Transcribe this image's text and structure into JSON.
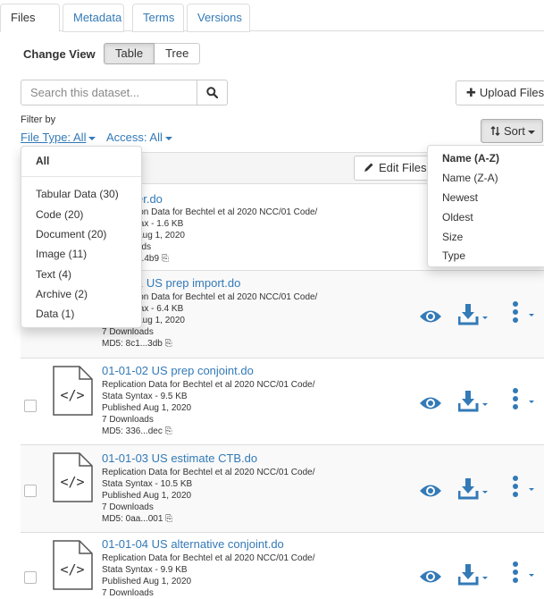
{
  "tabs": [
    "Files",
    "Metadata",
    "Terms",
    "Versions"
  ],
  "change_view": {
    "label": "Change View",
    "table": "Table",
    "tree": "Tree"
  },
  "search": {
    "placeholder": "Search this dataset..."
  },
  "upload_label": "Upload Files",
  "filter": {
    "by": "Filter by",
    "file_type": "File Type: All",
    "access": "Access: All"
  },
  "sort_label": "Sort",
  "edit_files_label": "Edit Files",
  "file_type_menu": {
    "all": "All",
    "items": [
      "Tabular Data (30)",
      "Code (20)",
      "Document (20)",
      "Image (11)",
      "Text (4)",
      "Archive (2)",
      "Data (1)"
    ]
  },
  "sort_menu": {
    "selected": "Name (A-Z)",
    "items": [
      "Name (Z-A)",
      "Newest",
      "Oldest",
      "Size",
      "Type"
    ]
  },
  "files": [
    {
      "name_visible": "er.do",
      "description_visible": "ion Data for Bechtel et al 2020 NCC/01 Code/",
      "type_size_visible": "tax - 1.6 KB",
      "published_visible": "Aug 1, 2020",
      "downloads_visible": "ads",
      "md5_visible": "...4b9"
    },
    {
      "name_visible": "1 US prep import.do",
      "description_visible": "ion Data for Bechtel et al 2020 NCC/01 Code/",
      "type_size_visible": "tax - 6.4 KB",
      "published_visible": "Aug 1, 2020",
      "downloads": "7 Downloads",
      "md5": "MD5: 8c1...3db"
    },
    {
      "name": "01-01-02 US prep conjoint.do",
      "description": "Replication Data for Bechtel et al 2020 NCC/01 Code/",
      "type_size": "Stata Syntax - 9.5 KB",
      "published": "Published Aug 1, 2020",
      "downloads": "7 Downloads",
      "md5": "MD5: 336...dec"
    },
    {
      "name": "01-01-03 US estimate CTB.do",
      "description": "Replication Data for Bechtel et al 2020 NCC/01 Code/",
      "type_size": "Stata Syntax - 10.5 KB",
      "published": "Published Aug 1, 2020",
      "downloads": "7 Downloads",
      "md5": "MD5: 0aa...001"
    },
    {
      "name": "01-01-04 US alternative conjoint.do",
      "description": "Replication Data for Bechtel et al 2020 NCC/01 Code/",
      "type_size": "Stata Syntax - 9.9 KB",
      "published": "Published Aug 1, 2020",
      "downloads": "7 Downloads"
    }
  ],
  "colors": {
    "link": "#337ab7",
    "action": "#337ab7"
  },
  "icons": [
    "search-icon",
    "plus-icon",
    "sort-icon",
    "pencil-icon",
    "file-code-icon",
    "eye-icon",
    "download-icon",
    "vertical-ellipsis-icon",
    "copy-icon"
  ]
}
